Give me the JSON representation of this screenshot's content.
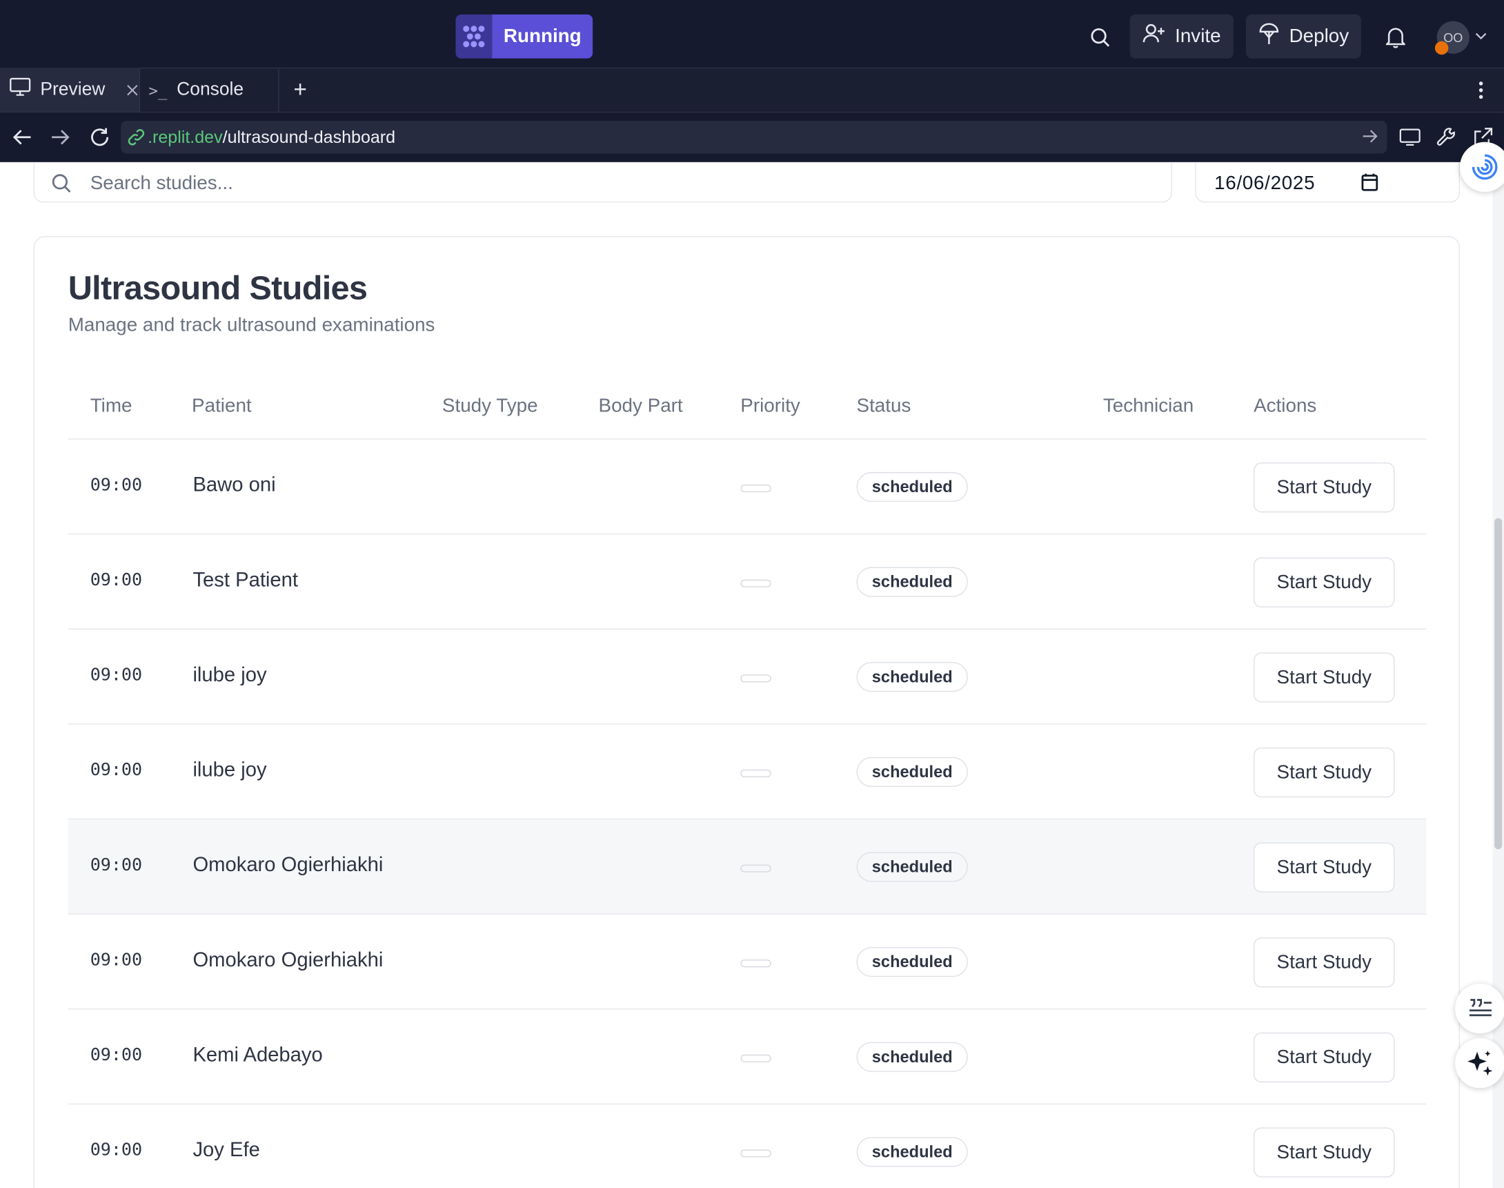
{
  "topbar": {
    "run_label": "Running",
    "invite_label": "Invite",
    "deploy_label": "Deploy",
    "avatar_initials": "OO"
  },
  "tabs": {
    "preview_label": "Preview",
    "console_label": "Console",
    "console_prompt": ">_",
    "add_tab": "+"
  },
  "urlbar": {
    "url_domain": ".replit.dev",
    "url_path": "/ultrasound-dashboard"
  },
  "filters": {
    "search_placeholder": "Search studies...",
    "date_value": "16/06/2025"
  },
  "card": {
    "title": "Ultrasound Studies",
    "subtitle": "Manage and track ultrasound examinations"
  },
  "table": {
    "headers": [
      "Time",
      "Patient",
      "Study Type",
      "Body Part",
      "Priority",
      "Status",
      "Technician",
      "Actions"
    ],
    "rows": [
      {
        "time": "09:00",
        "patient": "Bawo oni",
        "status": "scheduled",
        "action": "Start Study"
      },
      {
        "time": "09:00",
        "patient": "Test Patient",
        "status": "scheduled",
        "action": "Start Study"
      },
      {
        "time": "09:00",
        "patient": "ilube joy",
        "status": "scheduled",
        "action": "Start Study"
      },
      {
        "time": "09:00",
        "patient": "ilube joy",
        "status": "scheduled",
        "action": "Start Study"
      },
      {
        "time": "09:00",
        "patient": "Omokaro Ogierhiakhi",
        "status": "scheduled",
        "action": "Start Study"
      },
      {
        "time": "09:00",
        "patient": "Omokaro Ogierhiakhi",
        "status": "scheduled",
        "action": "Start Study"
      },
      {
        "time": "09:00",
        "patient": "Kemi Adebayo",
        "status": "scheduled",
        "action": "Start Study"
      },
      {
        "time": "09:00",
        "patient": "Joy Efe",
        "status": "scheduled",
        "action": "Start Study"
      }
    ]
  },
  "colors": {
    "topbar_bg": "#161a2e",
    "running_accent": "#5a4fd6",
    "url_domain": "#5bc77a",
    "row_hover": "#f6f7f9"
  }
}
